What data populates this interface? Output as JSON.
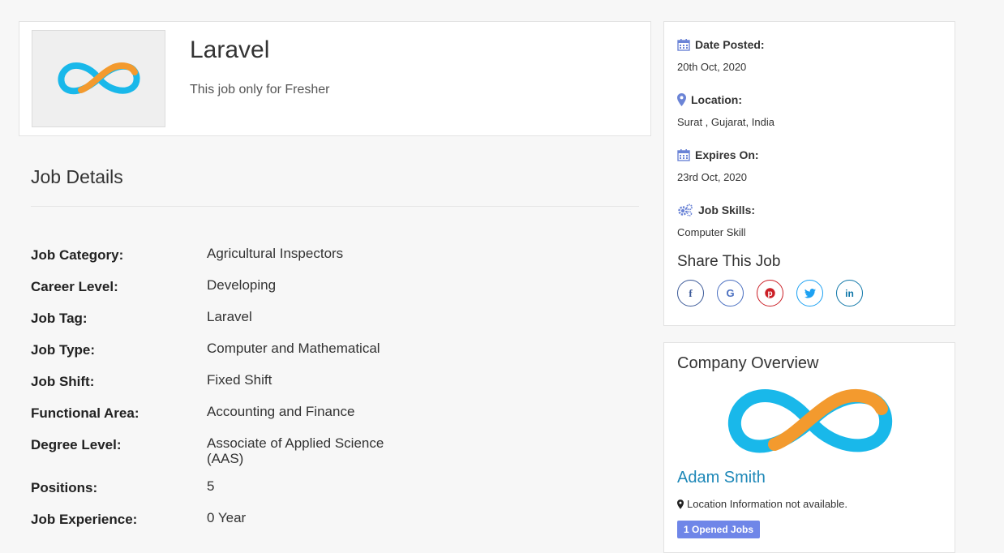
{
  "job": {
    "title": "Laravel",
    "subtitle": "This job only for Fresher"
  },
  "details": {
    "heading": "Job Details",
    "rows": [
      {
        "label": "Job Category:",
        "value": "Agricultural Inspectors"
      },
      {
        "label": "Career Level:",
        "value": "Developing"
      },
      {
        "label": "Job Tag:",
        "value": "Laravel"
      },
      {
        "label": "Job Type:",
        "value": "Computer and Mathematical"
      },
      {
        "label": "Job Shift:",
        "value": "Fixed Shift"
      },
      {
        "label": "Functional Area:",
        "value": "Accounting and Finance"
      },
      {
        "label": "Degree Level:",
        "value": "Associate of Applied Science (AAS)"
      },
      {
        "label": "Positions:",
        "value": "5"
      },
      {
        "label": "Job Experience:",
        "value": "0 Year"
      }
    ]
  },
  "sidebar": {
    "date_posted_label": "Date Posted:",
    "date_posted_value": "20th Oct, 2020",
    "location_label": "Location:",
    "location_value": "Surat , Gujarat, India",
    "expires_label": "Expires On:",
    "expires_value": "23rd Oct, 2020",
    "skills_label": "Job Skills:",
    "skills_value": "Computer Skill",
    "share_heading": "Share This Job",
    "share_icons": [
      "facebook-icon",
      "google-icon",
      "pinterest-icon",
      "twitter-icon",
      "linkedin-icon"
    ]
  },
  "company": {
    "heading": "Company Overview",
    "name": "Adam Smith",
    "location": "Location Information not available.",
    "opened_jobs": "1 Opened Jobs"
  },
  "colors": {
    "accent_icon": "#6b84d6",
    "company_name": "#1e88b8",
    "badge": "#6f86e8",
    "facebook": "#3b5998",
    "google": "#4a6fc0",
    "pinterest": "#cb2027",
    "twitter": "#1da1f2",
    "linkedin": "#0e76a8"
  }
}
